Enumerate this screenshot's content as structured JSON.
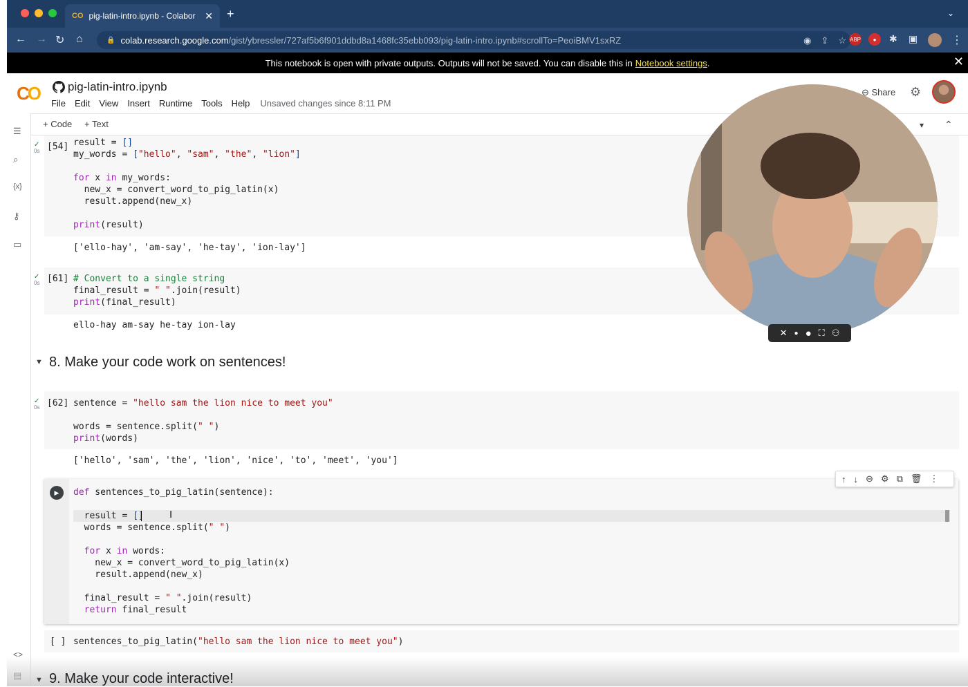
{
  "browser": {
    "tab_title": "pig-latin-intro.ipynb - Colabor",
    "tab_icon": "CO",
    "url_domain": "colab.research.google.com",
    "url_path": "/gist/ybressler/727af5b6f901ddbd8a1468fc35ebb093/pig-latin-intro.ipynb#scrollTo=PeoiBMV1sxRZ"
  },
  "infobar": {
    "message": "This notebook is open with private outputs. Outputs will not be saved. You can disable this in",
    "link": "Notebook settings",
    "end": "."
  },
  "colab": {
    "logo": "CO",
    "notebook_title": "pig-latin-intro.ipynb",
    "menu": [
      "File",
      "Edit",
      "View",
      "Insert",
      "Runtime",
      "Tools",
      "Help"
    ],
    "unsaved": "Unsaved changes since 8:11 PM",
    "share": "Share",
    "add_code": "+ Code",
    "add_text": "+ Text"
  },
  "cells": {
    "c54": {
      "prompt": "[54]",
      "time": "0s",
      "output": "['ello-hay', 'am-say', 'he-tay', 'ion-lay']"
    },
    "c61": {
      "prompt": "[61]",
      "time": "0s",
      "output": "ello-hay am-say he-tay ion-lay"
    },
    "heading8": "8. Make your code work on sentences!",
    "c62": {
      "prompt": "[62]",
      "time": "0s",
      "output": "['hello', 'sam', 'the', 'lion', 'nice', 'to', 'meet', 'you']"
    },
    "empty_prompt": "[ ]",
    "heading9": "9. Make your code interactive!"
  },
  "colors": {
    "keyword": "#9c27b0",
    "string": "#a31515",
    "comment": "#188038",
    "accent": "#f9ab00"
  }
}
